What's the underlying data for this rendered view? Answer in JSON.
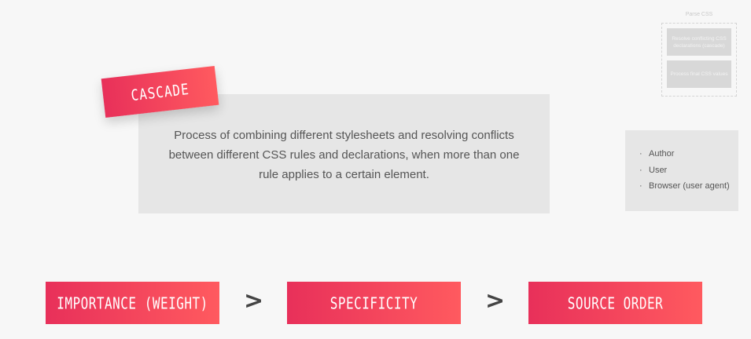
{
  "parse": {
    "title": "Parse CSS",
    "steps": [
      "Resolve conflicting CSS declarations (cascade)",
      "Process final CSS values"
    ]
  },
  "cascade": {
    "tag": "CASCADE",
    "description": "Process of combining different stylesheets and resolving conflicts between different CSS rules and declarations, when more than one rule applies to a certain element."
  },
  "sources": [
    "Author",
    "User",
    "Browser (user agent)"
  ],
  "priority": {
    "items": [
      "IMPORTANCE (WEIGHT)",
      "SPECIFICITY",
      "SOURCE ORDER"
    ],
    "separator": ">"
  },
  "colors": {
    "accent_start": "#e8305a",
    "accent_end": "#ff5a5f",
    "panel": "#e6e6e6"
  }
}
